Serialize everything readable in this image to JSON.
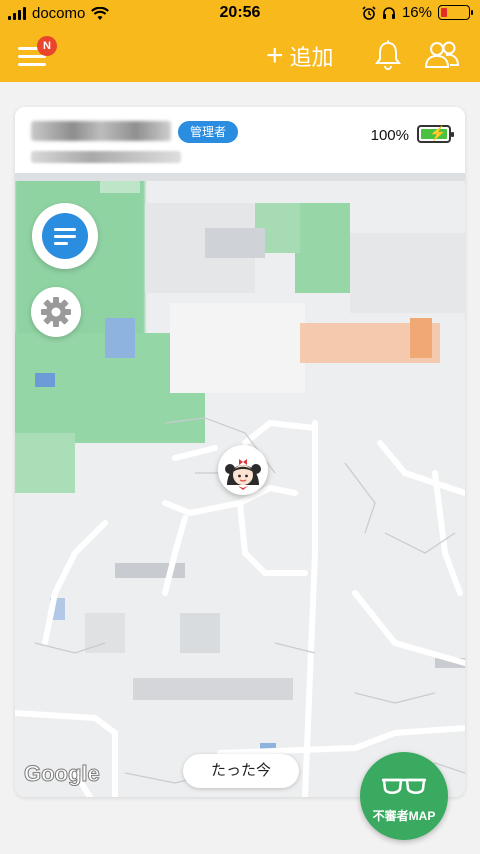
{
  "status_bar": {
    "carrier": "docomo",
    "time": "20:56",
    "battery_percent": "16%"
  },
  "header": {
    "menu_badge": "N",
    "add_label": "追加",
    "accent": "#f8b91c"
  },
  "card": {
    "role_badge": "管理者",
    "battery_text": "100%",
    "last_update": "たった今"
  },
  "map": {
    "attribution": "Google",
    "suspicious_map_label": "不審者MAP"
  },
  "colors": {
    "primary_blue": "#2a8de0",
    "green_fab": "#3aaa61",
    "badge_red": "#e8452c"
  }
}
